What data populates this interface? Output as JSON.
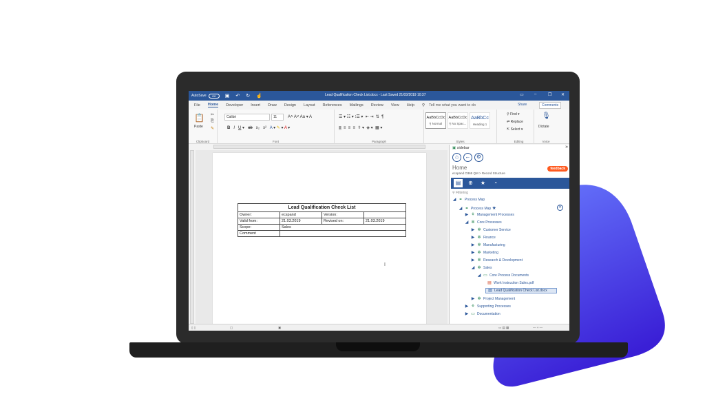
{
  "colors": {
    "titlebar": "#2b579a",
    "accent": "#2b579a",
    "feedback": "#ff5a1f",
    "blob_start": "#6a7dff",
    "blob_end": "#3a1fd6"
  },
  "titlebar": {
    "autosave": "AutoSave",
    "autosave_state": "Off",
    "doc_title": "Lead Qualification Check List.docx - Last Saved 21/03/2019 10:37"
  },
  "menu": {
    "items": [
      "File",
      "Home",
      "Developer",
      "Insert",
      "Draw",
      "Design",
      "Layout",
      "References",
      "Mailings",
      "Review",
      "View",
      "Help"
    ],
    "tell_me": "Tell me what you want to do",
    "share": "Share",
    "comments": "Comments"
  },
  "ribbon": {
    "clipboard_label": "Clipboard",
    "paste": "Paste",
    "font_label": "Font",
    "font_name": "Calibri",
    "font_size": "11",
    "paragraph_label": "Paragraph",
    "styles_label": "Styles",
    "styles": [
      {
        "sample": "AaBbCcDc",
        "name": "¶ Normal"
      },
      {
        "sample": "AaBbCcDc",
        "name": "¶ No Spac..."
      },
      {
        "sample": "AaBbCc",
        "name": "Heading 1"
      }
    ],
    "editing_label": "Editing",
    "find": "Find",
    "replace": "Replace",
    "select": "Select",
    "voice_label": "Voice",
    "dictate": "Dictate"
  },
  "document": {
    "table_title": "Lead Qualification Check List",
    "rows": [
      {
        "c1": "Owner:",
        "c2": "ecspand",
        "c3": "Version:",
        "c4": ""
      },
      {
        "c1": "Valid from:",
        "c2": "21.03.2019",
        "c3": "Revised on:",
        "c4": "21.03.2019"
      },
      {
        "c1": "Scope:",
        "c2": "Sales",
        "c3": "",
        "c4": ""
      },
      {
        "c1": "Comment",
        "c2": "",
        "c3": "",
        "c4": ""
      }
    ]
  },
  "sidebar": {
    "header": "sidebar",
    "title": "Home",
    "breadcrumb": "ecspand O365 QM > Record Structure",
    "feedback": "feedback",
    "filter_placeholder": "Filtering",
    "tree": [
      {
        "label": "Process Map",
        "expander": "◢"
      },
      {
        "label": "Process Map",
        "expander": "◢"
      },
      {
        "label": "Management Processes",
        "expander": "▶"
      },
      {
        "label": "Core Processes",
        "expander": "◢"
      },
      {
        "label": "Customer Service",
        "expander": "▶"
      },
      {
        "label": "Finance",
        "expander": "▶"
      },
      {
        "label": "Manufacturing",
        "expander": "▶"
      },
      {
        "label": "Marketing",
        "expander": "▶"
      },
      {
        "label": "Research & Development",
        "expander": "▶"
      },
      {
        "label": "Sales",
        "expander": "◢"
      },
      {
        "label": "Core Process Documents",
        "expander": "◢"
      },
      {
        "label": "Work Instruction Sales.pdf",
        "expander": ""
      },
      {
        "label": "Lead Qualification Check List.docx",
        "expander": ""
      },
      {
        "label": "Project Management",
        "expander": "▶"
      },
      {
        "label": "Supporting Processes",
        "expander": "▶"
      },
      {
        "label": "Documentation",
        "expander": "▶"
      }
    ]
  }
}
